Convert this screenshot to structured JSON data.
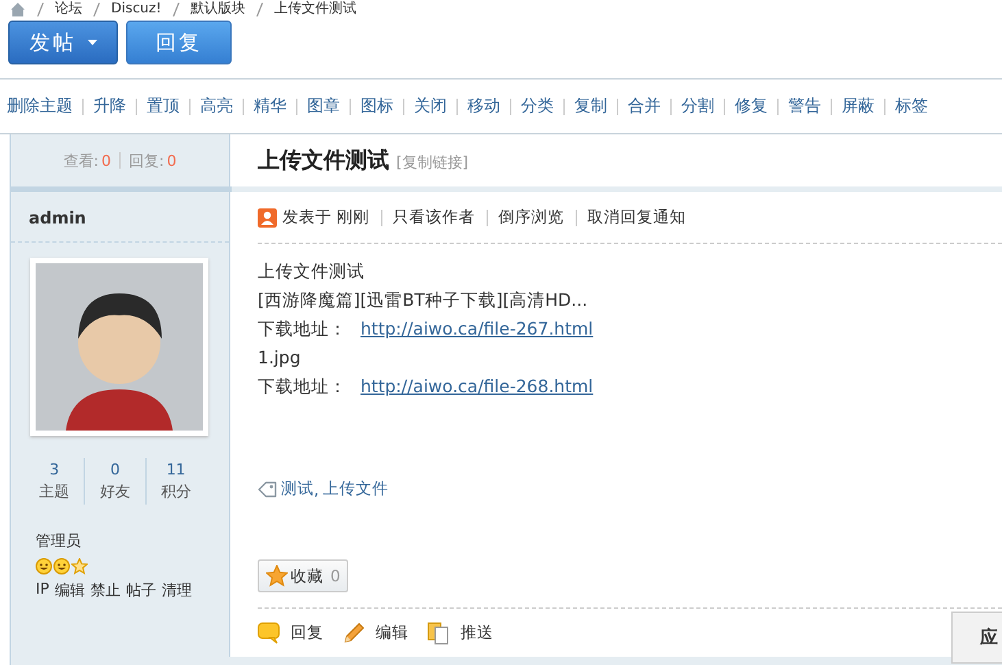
{
  "breadcrumb": [
    "论坛",
    "Discuz!",
    "默认版块",
    "上传文件测试"
  ],
  "buttons": [
    {
      "label": "发帖",
      "dropdown": true
    },
    {
      "label": "回复",
      "dropdown": false
    }
  ],
  "mod_actions": [
    "删除主题",
    "升降",
    "置顶",
    "高亮",
    "精华",
    "图章",
    "图标",
    "关闭",
    "移动",
    "分类",
    "复制",
    "合并",
    "分割",
    "修复",
    "警告",
    "屏蔽",
    "标签"
  ],
  "thread": {
    "views_label": "查看:",
    "views": "0",
    "replies_label": "回复:",
    "replies": "0",
    "title": "上传文件测试",
    "copy_link": "[复制链接]"
  },
  "author": {
    "name": "admin",
    "stats": [
      {
        "value": "3",
        "label": "主题"
      },
      {
        "value": "0",
        "label": "好友"
      },
      {
        "value": "11",
        "label": "积分"
      }
    ],
    "group": "管理员",
    "links": [
      "IP",
      "编辑",
      "禁止",
      "帖子",
      "清理"
    ]
  },
  "post": {
    "posted": "发表于 刚刚",
    "links": [
      "只看该作者",
      "倒序浏览",
      "取消回复通知"
    ],
    "lines": [
      {
        "kind": "text",
        "text": "上传文件测试"
      },
      {
        "kind": "text",
        "text": "[西游降魔篇][迅雷BT种子下载][高清HD..."
      },
      {
        "kind": "download",
        "label": "下载地址：",
        "url": "http://aiwo.ca/file-267.html"
      },
      {
        "kind": "text",
        "text": "1.jpg"
      },
      {
        "kind": "download",
        "label": "下载地址：",
        "url": "http://aiwo.ca/file-268.html"
      }
    ],
    "tags": [
      "测试",
      "上传文件"
    ],
    "tag_separator": ",",
    "favorite": {
      "label": "收藏",
      "count": "0"
    },
    "actions": [
      {
        "kind": "reply",
        "label": "回复"
      },
      {
        "kind": "edit",
        "label": "编辑"
      },
      {
        "kind": "push",
        "label": "推送"
      }
    ]
  },
  "side_tab": "应"
}
